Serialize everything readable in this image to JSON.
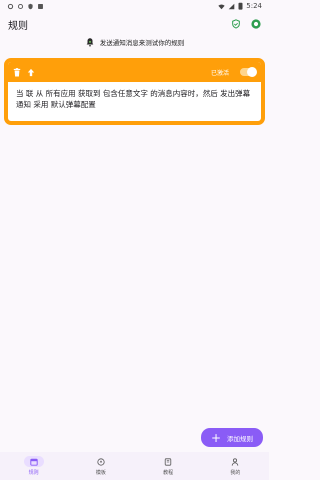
{
  "status_bar": {
    "time": "5:24"
  },
  "app_bar": {
    "title": "规则"
  },
  "notice": {
    "text": "发送通知消息来测试你的规则"
  },
  "rule_card": {
    "status_label": "已激活",
    "enabled": true,
    "accent": "#ff9f0a",
    "description": "当 联 从 所有应用 获取到 包含任意文字 的消息内容时，然后 发出弹幕通知 采用 默认弹幕配置"
  },
  "fab": {
    "label": "添加规则",
    "color": "#8a5cf6"
  },
  "bottom_nav": {
    "items": [
      {
        "label": "规则",
        "icon": "calendar-icon",
        "active": true
      },
      {
        "label": "模板",
        "icon": "template-icon",
        "active": false
      },
      {
        "label": "教程",
        "icon": "book-icon",
        "active": false
      },
      {
        "label": "我的",
        "icon": "person-icon",
        "active": false
      }
    ]
  }
}
